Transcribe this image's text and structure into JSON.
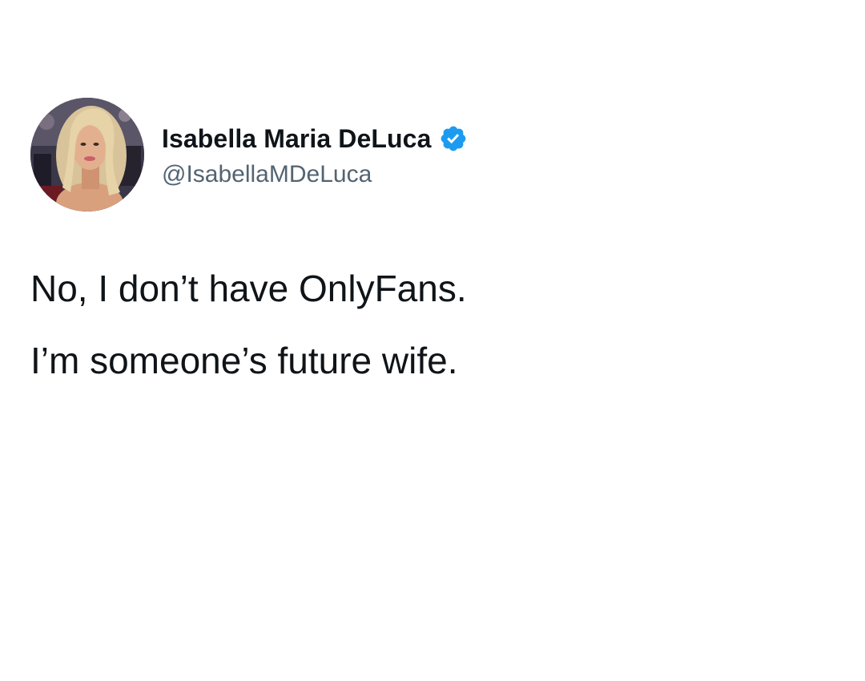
{
  "user": {
    "display_name": "Isabella Maria DeLuca",
    "handle": "@IsabellaMDeLuca",
    "verified": true,
    "avatar_icon": "profile-photo",
    "verified_icon": "verified-badge-icon"
  },
  "tweet": {
    "lines": [
      "No, I don’t have OnlyFans.",
      "I’m someone’s future wife."
    ]
  },
  "colors": {
    "background": "#ffffff",
    "text_primary": "#0f1419",
    "text_secondary": "#536471",
    "verified_blue": "#1d9bf0"
  }
}
